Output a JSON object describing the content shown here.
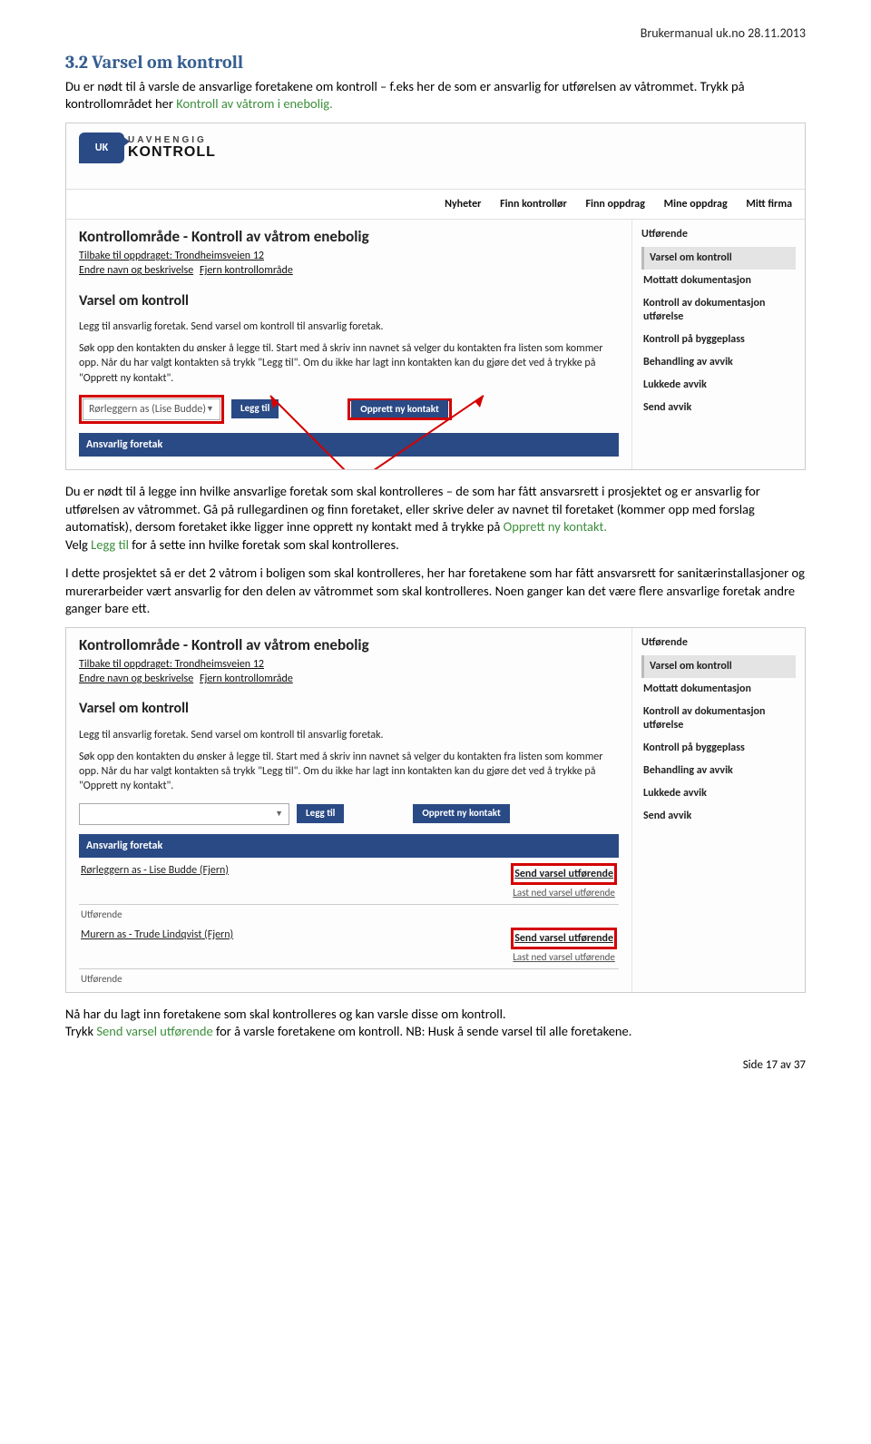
{
  "header": {
    "right": "Brukermanual uk.no 28.11.2013"
  },
  "section": {
    "number_title": "3.2  Varsel om kontroll",
    "intro_line1": "Du er nødt til å varsle de ansvarlige foretakene om kontroll – f.eks her de som er ansvarlig for utførelsen av våtrommet. Trykk på kontrollområdet her ",
    "intro_green": "Kontroll av våtrom i enebolig."
  },
  "shot1": {
    "logo_badge": "UK",
    "logo_line1": "UAVHENGIG",
    "logo_line2": "KONTROLL",
    "nav": [
      "Nyheter",
      "Finn kontrollør",
      "Finn oppdrag",
      "Mine oppdrag",
      "Mitt firma"
    ],
    "area_title": "Kontrollområde - Kontroll av våtrom enebolig",
    "back_link": "Tilbake til oppdraget: Trondheimsveien 12",
    "edit_link": "Endre navn og beskrivelse",
    "remove_link": "Fjern kontrollområde",
    "varsel_title": "Varsel om kontroll",
    "helper1": "Legg til ansvarlig foretak. Send varsel om kontroll til ansvarlig foretak.",
    "helper2": "Søk opp den kontakten du ønsker å legge til. Start med å skriv inn navnet så velger du kontakten fra listen som kommer opp. Når du har valgt kontakten så trykk \"Legg til\". Om du ikke har lagt inn kontakten kan du gjøre det ved å trykke på \"Opprett ny kontakt\".",
    "dropdown_value": "Rørleggern as (Lise Budde)",
    "btn_add": "Legg til",
    "btn_new": "Opprett ny kontakt",
    "bar": "Ansvarlig foretak",
    "side_head": "Utførende",
    "side_items": [
      "Varsel om kontroll",
      "Mottatt dokumentasjon",
      "Kontroll av dokumentasjon utførelse",
      "Kontroll på byggeplass",
      "Behandling av avvik",
      "Lukkede avvik",
      "Send avvik"
    ]
  },
  "para2": {
    "a": "Du er nødt til å legge inn hvilke ansvarlige foretak som skal kontrolleres – de som har fått ansvarsrett i prosjektet og er ansvarlig for utførelsen av våtrommet. Gå på rullegardinen og finn foretaket, eller skrive deler av navnet til foretaket (kommer opp med forslag automatisk), dersom foretaket ikke ligger inne opprett ny kontakt med å trykke på ",
    "a_green": "Opprett ny kontakt.",
    "b_pre": "Velg ",
    "b_green": "Legg til",
    "b_post": " for å sette inn hvilke foretak som skal kontrolleres."
  },
  "para3": "I dette prosjektet så er det 2 våtrom i boligen som skal kontrolleres, her har foretakene som har fått ansvarsrett for sanitærinstallasjoner og murerarbeider vært ansvarlig for den delen av våtrommet som skal kontrolleres. Noen ganger kan det være flere ansvarlige foretak andre ganger bare ett.",
  "shot2": {
    "area_title": "Kontrollområde - Kontroll av våtrom enebolig",
    "back_link": "Tilbake til oppdraget: Trondheimsveien 12",
    "edit_link": "Endre navn og beskrivelse",
    "remove_link": "Fjern kontrollområde",
    "varsel_title": "Varsel om kontroll",
    "helper1": "Legg til ansvarlig foretak. Send varsel om kontroll til ansvarlig foretak.",
    "helper2": "Søk opp den kontakten du ønsker å legge til. Start med å skriv inn navnet så velger du kontakten fra listen som kommer opp. Når du har valgt kontakten så trykk \"Legg til\". Om du ikke har lagt inn kontakten kan du gjøre det ved å trykke på \"Opprett ny kontakt\".",
    "btn_add": "Legg til",
    "btn_new": "Opprett ny kontakt",
    "bar": "Ansvarlig foretak",
    "resp1_name": "Rørleggern as - Lise Budde (Fjern)",
    "resp2_name": "Murern as - Trude Lindqvist (Fjern)",
    "send_link": "Send varsel utførende",
    "last_link": "Last ned varsel utførende",
    "utforende": "Utførende",
    "side_head": "Utførende",
    "side_items": [
      "Varsel om kontroll",
      "Mottatt dokumentasjon",
      "Kontroll av dokumentasjon utførelse",
      "Kontroll på byggeplass",
      "Behandling av avvik",
      "Lukkede avvik",
      "Send avvik"
    ]
  },
  "para4": {
    "a": "Nå har du lagt inn foretakene som skal kontrolleres og kan varsle disse om kontroll.",
    "b_pre": "Trykk ",
    "b_green": "Send varsel utførende",
    "b_post": " for å varsle foretakene om kontroll. NB: Husk å sende varsel til alle foretakene."
  },
  "footer": {
    "page": "Side 17 av 37"
  }
}
